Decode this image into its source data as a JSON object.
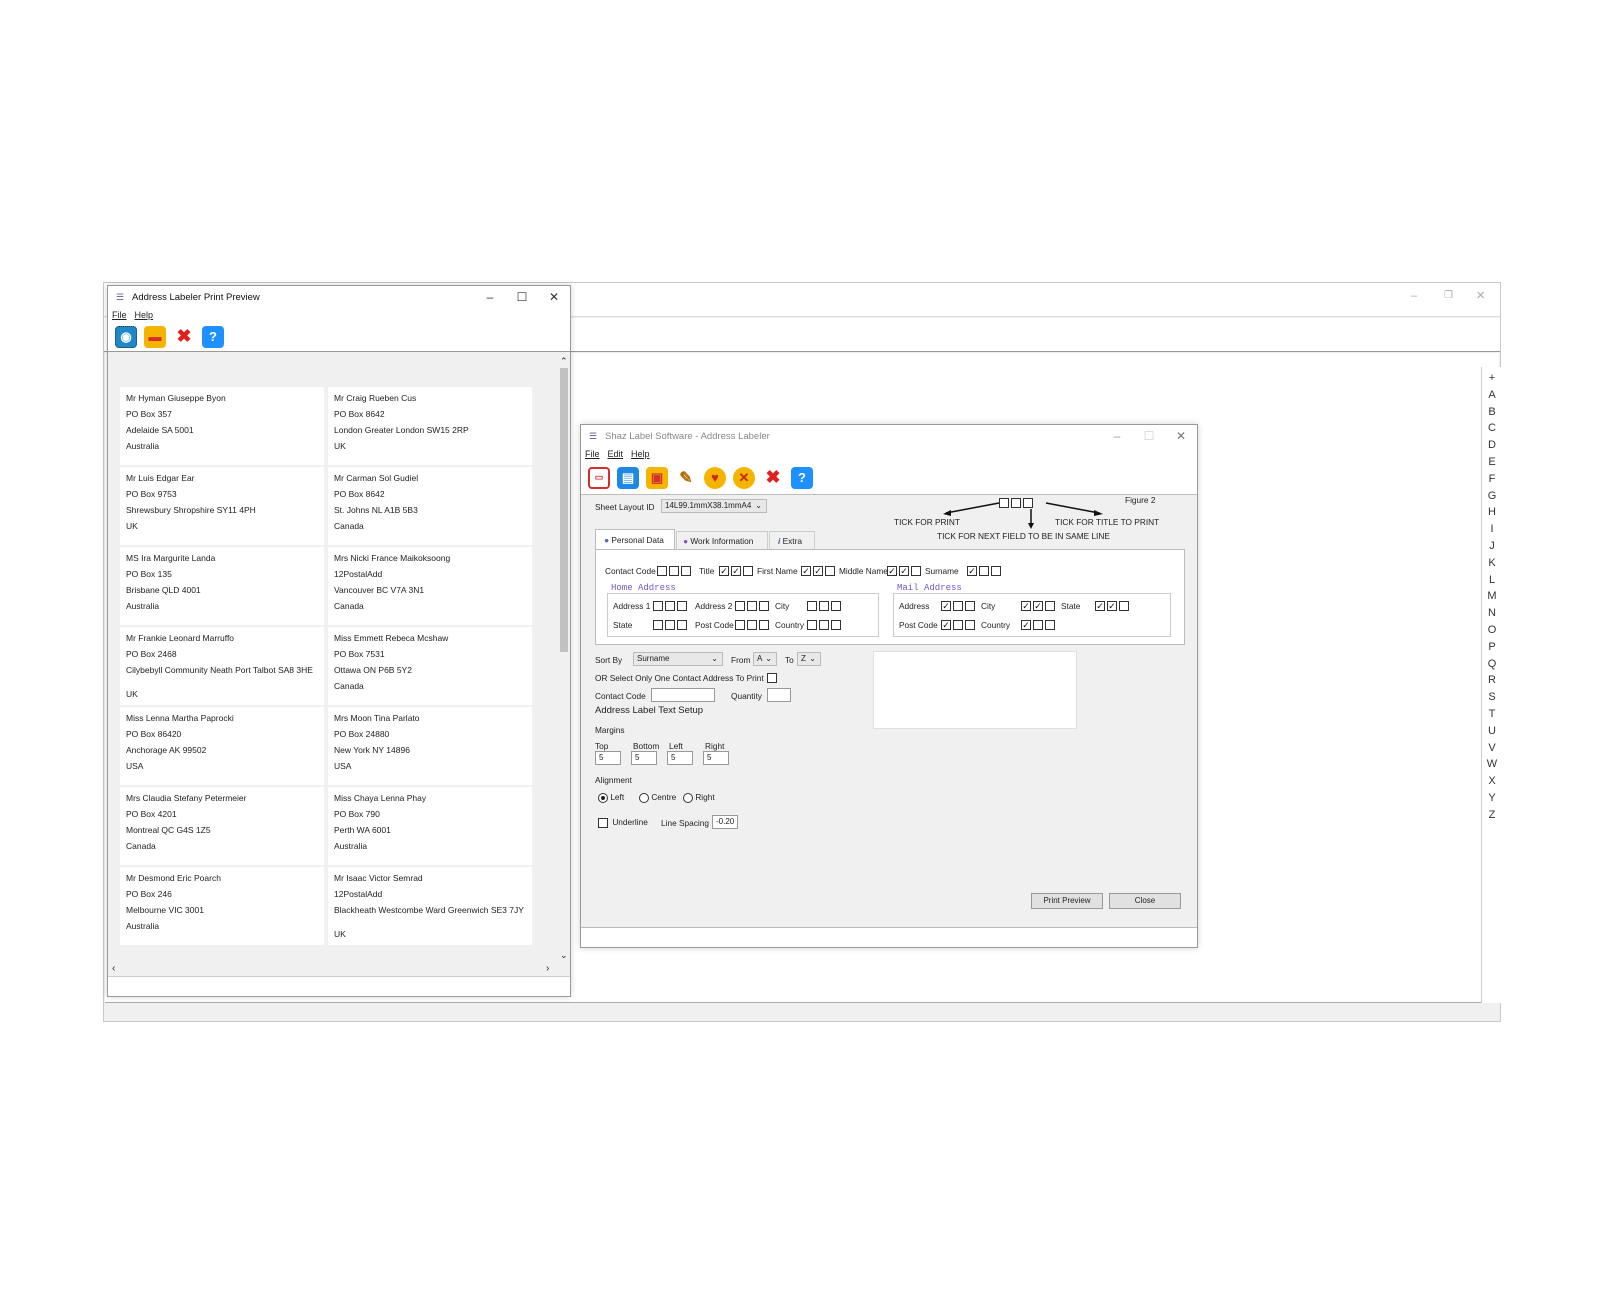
{
  "background_window": {
    "controls": {
      "minimize": "–",
      "restore": "❐",
      "close": "✕"
    },
    "alphabet": [
      "+",
      "A",
      "B",
      "C",
      "D",
      "E",
      "F",
      "G",
      "H",
      "I",
      "J",
      "K",
      "L",
      "M",
      "N",
      "O",
      "P",
      "Q",
      "R",
      "S",
      "T",
      "U",
      "V",
      "W",
      "X",
      "Y",
      "Z"
    ]
  },
  "preview_window": {
    "title": "Address Labeler Print Preview",
    "controls": {
      "minimize": "–",
      "maximize": "☐",
      "close": "✕"
    },
    "menu": [
      "File",
      "Help"
    ],
    "labels": [
      [
        "Mr Hyman Giuseppe Byon",
        "PO Box 357",
        "Adelaide SA 5001",
        "Australia"
      ],
      [
        "Mr Craig Rueben Cus",
        "PO Box 8642",
        "London Greater London SW15 2RP",
        "UK"
      ],
      [
        "Mr Luis Edgar Ear",
        "PO Box 9753",
        "Shrewsbury Shropshire SY11 4PH",
        "UK"
      ],
      [
        "Mr Carman Sol Gudiel",
        "PO Box 8642",
        "St. Johns NL A1B 5B3",
        "Canada"
      ],
      [
        "MS Ira Margurite Landa",
        "PO Box 135",
        "Brisbane QLD 4001",
        "Australia"
      ],
      [
        "Mrs Nicki France Maikoksoong",
        "12PostalAdd",
        "Vancouver BC V7A 3N1",
        "Canada"
      ],
      [
        "Mr Frankie Leonard Marruffo",
        "PO Box 2468",
        "Cilybebyll Community Neath Port Talbot SA8 3HE",
        "UK"
      ],
      [
        "Miss Emmett Rebeca Mcshaw",
        "PO Box 7531",
        "Ottawa ON P6B 5Y2",
        "Canada"
      ],
      [
        "Miss Lenna Martha Paprocki",
        "PO Box 86420",
        "Anchorage AK 99502",
        "USA"
      ],
      [
        "Mrs Moon Tina Parlato",
        "PO Box 24880",
        "New York NY 14896",
        "USA"
      ],
      [
        "Mrs Claudia Stefany Petermeier",
        "PO Box 4201",
        "Montreal QC G4S 1Z5",
        "Canada"
      ],
      [
        "Miss Chaya Lenna Phay",
        "PO Box 790",
        "Perth WA 6001",
        "Australia"
      ],
      [
        "Mr Desmond Eric Poarch",
        "PO Box 246",
        "Melbourne VIC 3001",
        "Australia"
      ],
      [
        "Mr Isaac Victor Semrad",
        "12PostalAdd",
        "Blackheath Westcombe Ward Greenwich SE3 7JY",
        "UK"
      ]
    ]
  },
  "main_window": {
    "title": "Shaz Label Software - Address Labeler",
    "controls": {
      "minimize": "–",
      "maximize": "☐",
      "close": "✕"
    },
    "menu": [
      "File",
      "Edit",
      "Help"
    ],
    "sheet_layout_label": "Sheet Layout ID",
    "sheet_layout_value": "14L99.1mmX38.1mmA4",
    "figure_label": "Figure 2",
    "tick_print": "TICK FOR PRINT",
    "tick_title": "TICK FOR TITLE TO PRINT",
    "tick_same_line": "TICK FOR NEXT FIELD TO BE IN SAME LINE",
    "tabs": [
      "Personal Data",
      "Work Information",
      "Extra"
    ],
    "fields": {
      "contact_code": "Contact Code",
      "title": "Title",
      "first_name": "First Name",
      "middle_name": "Middle Name",
      "surname": "Surname"
    },
    "home_address": {
      "heading": "Home Address",
      "address1": "Address 1",
      "address2": "Address 2",
      "city": "City",
      "state": "State",
      "post_code": "Post Code",
      "country": "Country"
    },
    "mail_address": {
      "heading": "Mail Address",
      "address": "Address",
      "city": "City",
      "state": "State",
      "post_code": "Post Code",
      "country": "Country"
    },
    "sort_by_label": "Sort By",
    "sort_by_value": "Surname",
    "from_label": "From",
    "from_value": "A",
    "to_label": "To",
    "to_value": "Z",
    "select_one_label": "OR Select Only One Contact Address To Print",
    "contact_code_label": "Contact Code",
    "quantity_label": "Quantity",
    "text_setup_heading": "Address Label Text Setup",
    "margins_label": "Margins",
    "margin_top_label": "Top",
    "margin_bottom_label": "Bottom",
    "margin_left_label": "Left",
    "margin_right_label": "Right",
    "margin_top": "5",
    "margin_bottom": "5",
    "margin_left": "5",
    "margin_right": "5",
    "alignment_label": "Alignment",
    "align_left": "Left",
    "align_centre": "Centre",
    "align_right": "Right",
    "underline_label": "Underline",
    "line_spacing_label": "Line Spacing",
    "line_spacing_value": "-0.20",
    "print_preview_button": "Print Preview",
    "close_button": "Close"
  }
}
